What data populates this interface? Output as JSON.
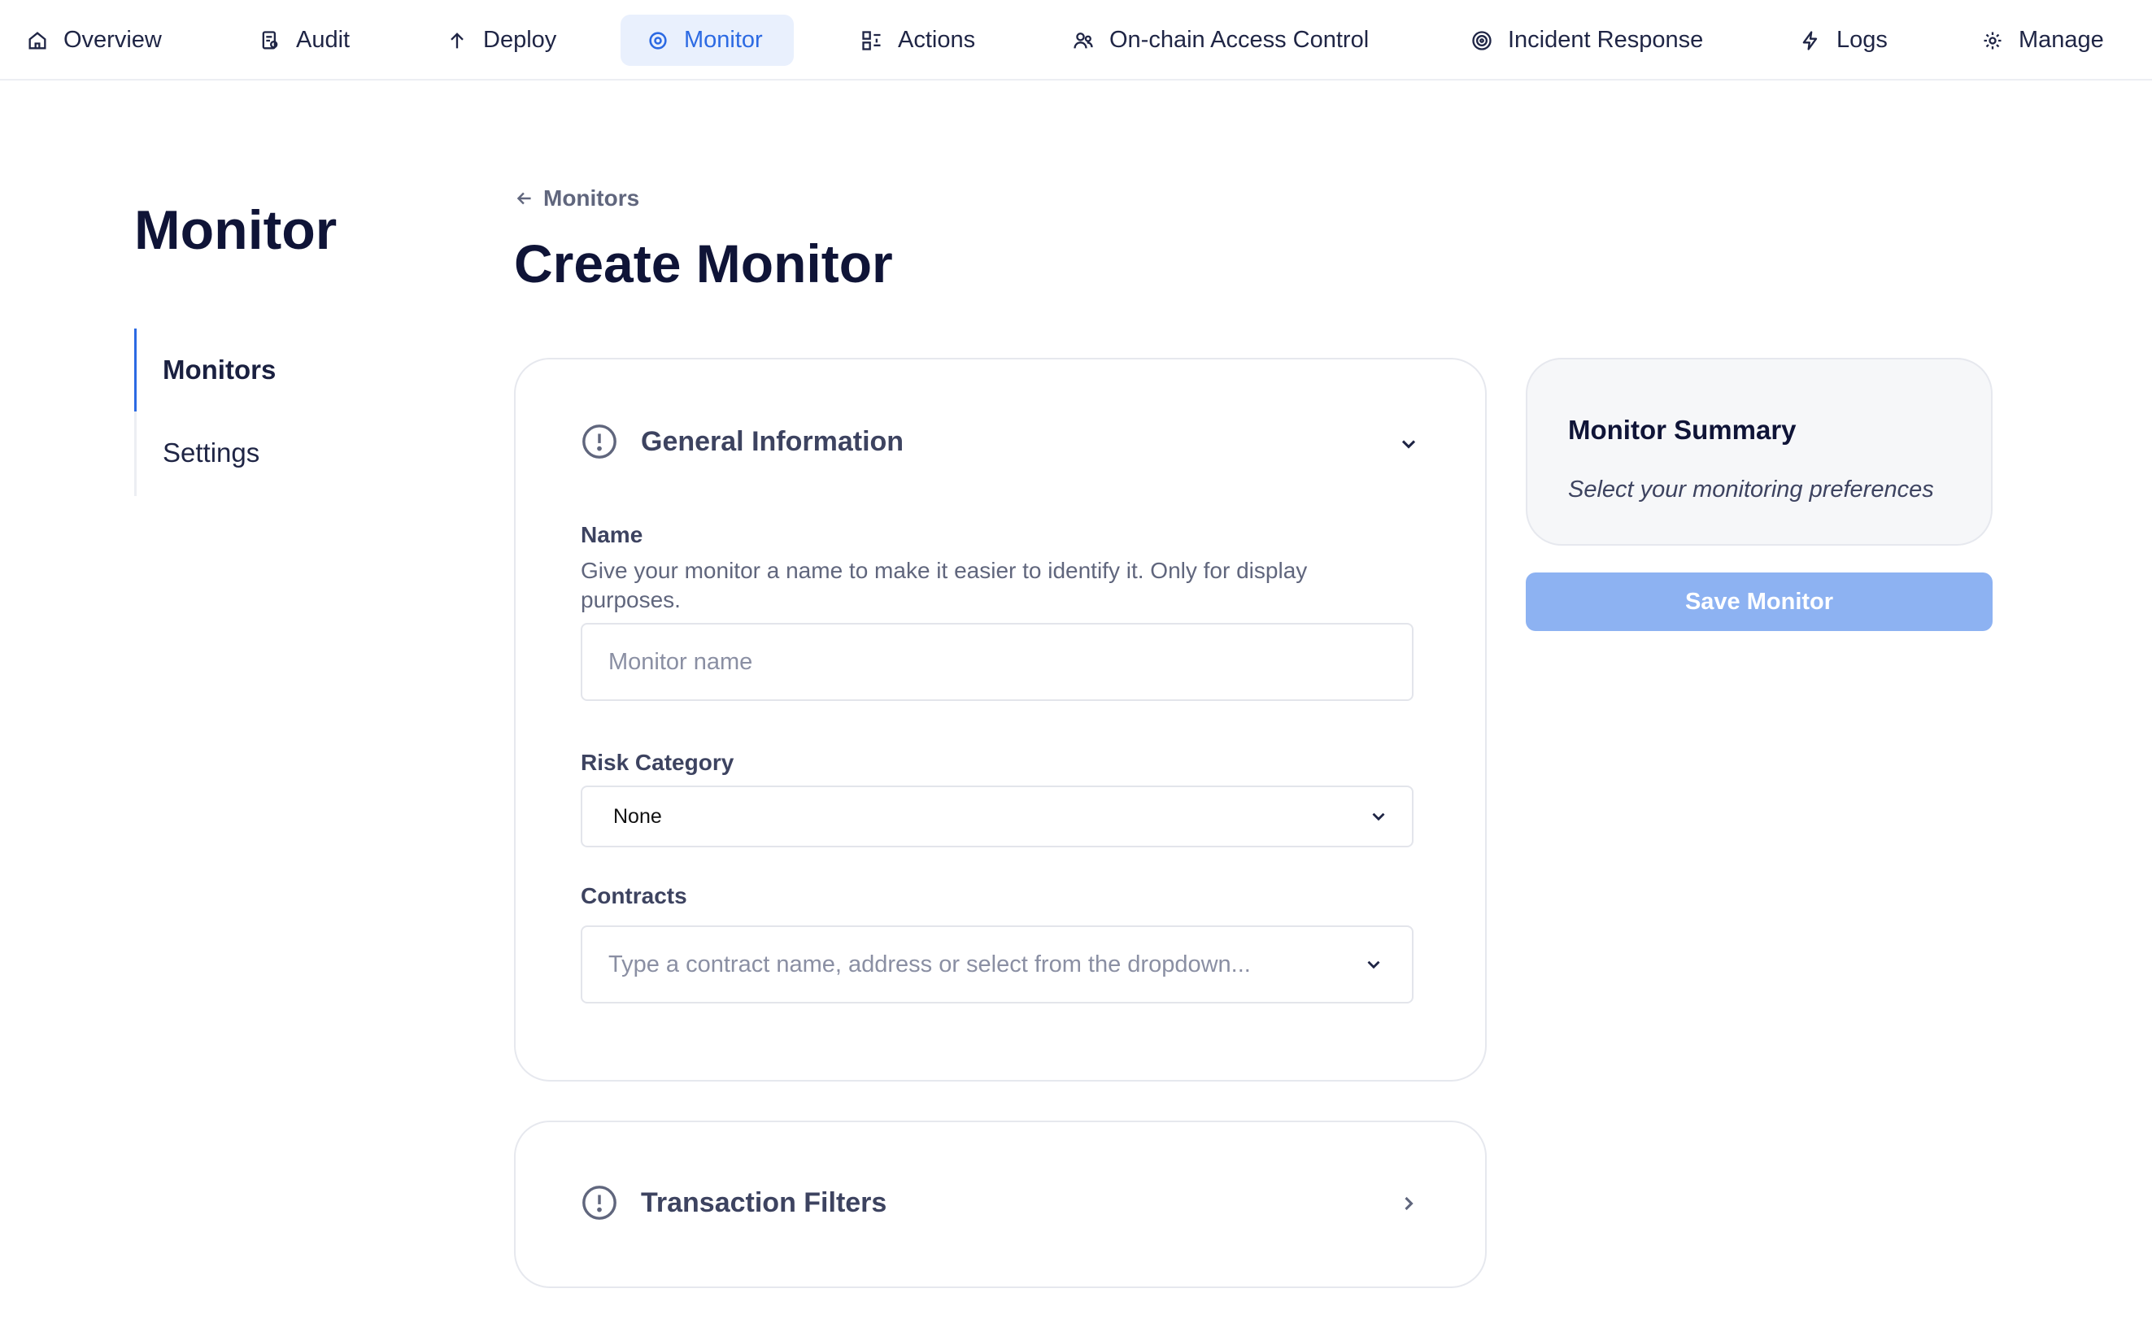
{
  "nav": {
    "items": [
      {
        "label": "Overview",
        "icon": "home-icon"
      },
      {
        "label": "Audit",
        "icon": "audit-icon"
      },
      {
        "label": "Deploy",
        "icon": "upload-arrow-icon"
      },
      {
        "label": "Monitor",
        "icon": "target-icon",
        "active": true
      },
      {
        "label": "Actions",
        "icon": "actions-icon"
      },
      {
        "label": "On-chain Access Control",
        "icon": "users-icon"
      },
      {
        "label": "Incident Response",
        "icon": "radar-icon"
      },
      {
        "label": "Logs",
        "icon": "bolt-icon"
      },
      {
        "label": "Manage",
        "icon": "gear-icon"
      }
    ],
    "active_color": "#2c6ae3"
  },
  "sidebar": {
    "title": "Monitor",
    "items": [
      {
        "label": "Monitors",
        "active": true
      },
      {
        "label": "Settings",
        "active": false
      }
    ]
  },
  "header": {
    "back_label": "Monitors",
    "title": "Create Monitor"
  },
  "general": {
    "title": "General Information",
    "name_label": "Name",
    "name_help": "Give your monitor a name to make it easier to identify it. Only for display purposes.",
    "name_placeholder": "Monitor name",
    "risk_label": "Risk Category",
    "risk_value": "None",
    "contracts_label": "Contracts",
    "contracts_placeholder": "Type a contract name, address or select from the dropdown..."
  },
  "filters": {
    "title": "Transaction Filters"
  },
  "summary": {
    "title": "Monitor Summary",
    "subtitle": "Select your monitoring preferences",
    "save_label": "Save Monitor",
    "save_color": "#8db2f2"
  }
}
